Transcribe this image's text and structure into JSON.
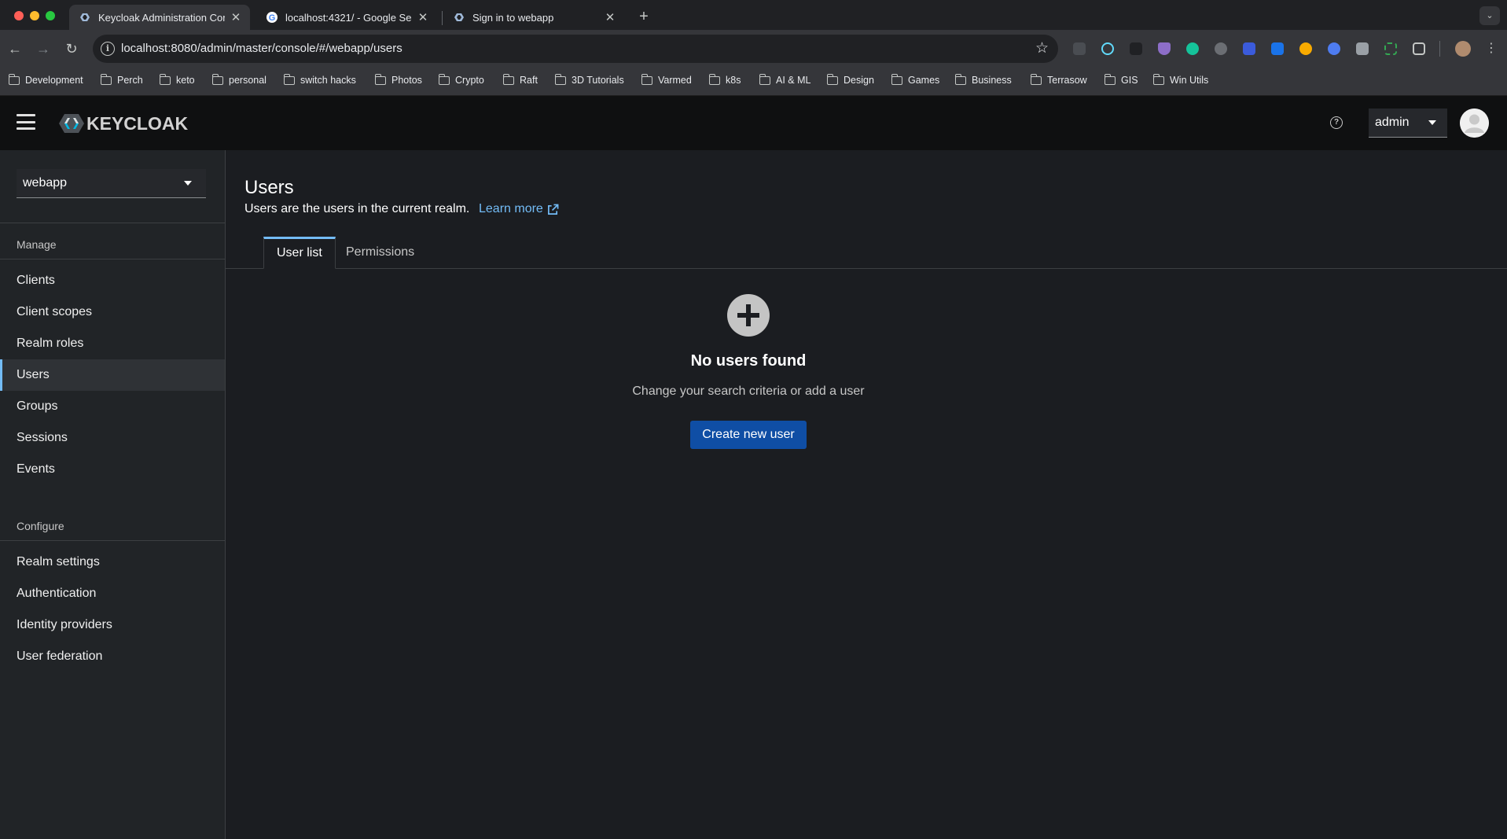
{
  "browser": {
    "tabs": [
      {
        "title": "Keycloak Administration Cons",
        "active": true
      },
      {
        "title": "localhost:4321/ - Google Sea",
        "active": false
      },
      {
        "title": "Sign in to webapp",
        "active": false
      }
    ],
    "url": "localhost:8080/admin/master/console/#/webapp/users",
    "bookmarks": [
      "Development",
      "Perch",
      "keto",
      "personal",
      "switch hacks",
      "Photos",
      "Crypto",
      "Raft",
      "3D Tutorials",
      "Varmed",
      "k8s",
      "AI & ML",
      "Design",
      "Games",
      "Business",
      "Terrasow",
      "GIS",
      "Win Utils"
    ]
  },
  "header": {
    "logo_text": "KEYCLOAK",
    "user": "admin"
  },
  "sidebar": {
    "realm": "webapp",
    "manage_title": "Manage",
    "manage_items": [
      "Clients",
      "Client scopes",
      "Realm roles",
      "Users",
      "Groups",
      "Sessions",
      "Events"
    ],
    "configure_title": "Configure",
    "configure_items": [
      "Realm settings",
      "Authentication",
      "Identity providers",
      "User federation"
    ],
    "active_item": "Users"
  },
  "main": {
    "title": "Users",
    "description": "Users are the users in the current realm.",
    "learn_more": "Learn more",
    "tabs": [
      "User list",
      "Permissions"
    ],
    "empty_title": "No users found",
    "empty_body": "Change your search criteria or add a user",
    "create_button": "Create new user"
  }
}
